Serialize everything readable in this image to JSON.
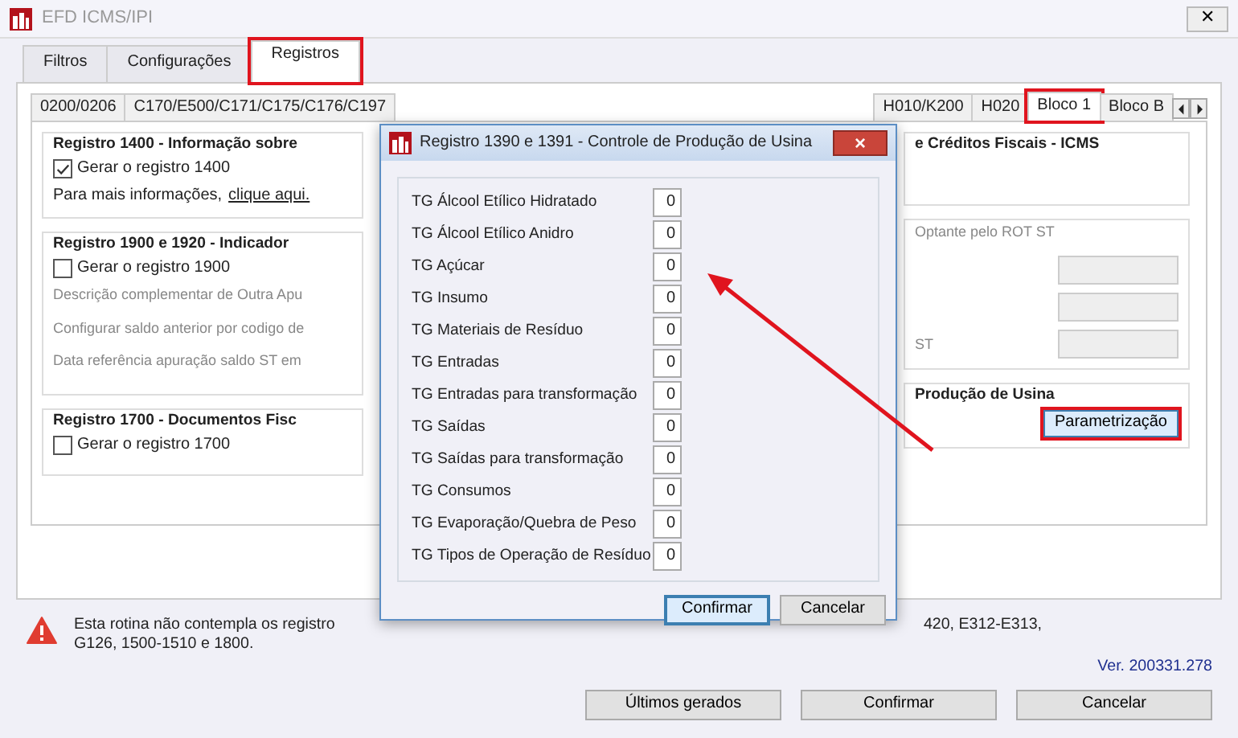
{
  "window": {
    "title": "EFD ICMS/IPI",
    "close": "✕"
  },
  "tabs": [
    {
      "label": "Filtros",
      "selected": false,
      "highlighted": false
    },
    {
      "label": "Configurações",
      "selected": false,
      "highlighted": false
    },
    {
      "label": "Registros",
      "selected": true,
      "highlighted": true
    }
  ],
  "sub_tabs_left": [
    {
      "label": "0200/0206",
      "selected": false,
      "highlighted": false
    },
    {
      "label": "C170/E500/C171/C175/C176/C197",
      "selected": false,
      "highlighted": false
    }
  ],
  "sub_tabs_right": [
    {
      "label": "H010/K200",
      "selected": false,
      "highlighted": false
    },
    {
      "label": "H020",
      "selected": false,
      "highlighted": false
    },
    {
      "label": "Bloco 1",
      "selected": true,
      "highlighted": true
    },
    {
      "label": "Bloco B",
      "selected": false,
      "highlighted": false
    }
  ],
  "left_groups": [
    {
      "title": "Registro 1400 - Informação sobre",
      "items": [
        {
          "kind": "checkbox",
          "label": "Gerar o registro 1400",
          "checked": true
        },
        {
          "kind": "link_line",
          "text": "Para mais informações, ",
          "link": "clique aqui."
        }
      ]
    },
    {
      "title": "Registro 1900 e 1920 - Indicador",
      "items": [
        {
          "kind": "checkbox",
          "label": "Gerar o registro 1900",
          "checked": false
        },
        {
          "kind": "note",
          "text": "Descrição complementar de Outra Apu"
        },
        {
          "kind": "note",
          "text": "Configurar saldo anterior por codigo de"
        },
        {
          "kind": "note",
          "text": "Data referência apuração saldo ST em"
        }
      ]
    },
    {
      "title": "Registro 1700 - Documentos Fisc",
      "items": [
        {
          "kind": "checkbox",
          "label": "Gerar o registro 1700",
          "checked": false
        }
      ]
    }
  ],
  "right_groups": [
    {
      "title": "e Créditos Fiscais - ICMS"
    },
    {
      "items": [
        {
          "kind": "note",
          "text": "Optante pelo ROT ST"
        },
        {
          "kind": "field"
        },
        {
          "kind": "field"
        },
        {
          "kind": "labeled_field",
          "text": "ST"
        }
      ]
    },
    {
      "title": "Produção de Usina",
      "items": [
        {
          "kind": "button",
          "label": "Parametrização",
          "highlighted": true
        }
      ]
    }
  ],
  "notice": {
    "line_1_start": "Esta rotina não contempla os registro",
    "line_1_end": "420, E312-E313,",
    "line_2": "G126, 1500-1510 e 1800.",
    "version": "Ver. 200331.278"
  },
  "buttons": [
    "Últimos gerados",
    "Confirmar",
    "Cancelar"
  ],
  "dialog": {
    "title": "Registro 1390 e 1391 - Controle de Produção de Usina",
    "close": "×",
    "fields": [
      {
        "label": "TG Álcool Etílico Hidratado",
        "value": "0"
      },
      {
        "label": "TG Álcool Etílico Anidro",
        "value": "0"
      },
      {
        "label": "TG Açúcar",
        "value": "0"
      },
      {
        "label": "TG Insumo",
        "value": "0"
      },
      {
        "label": "TG Materiais de Resíduo",
        "value": "0"
      },
      {
        "label": "TG Entradas",
        "value": "0"
      },
      {
        "label": "TG Entradas para transformação",
        "value": "0"
      },
      {
        "label": "TG Saídas",
        "value": "0"
      },
      {
        "label": "TG Saídas para transformação",
        "value": "0"
      },
      {
        "label": "TG Consumos",
        "value": "0"
      },
      {
        "label": "TG Evaporação/Quebra de Peso",
        "value": "0"
      },
      {
        "label": "TG Tipos de Operação de Resíduo",
        "value": "0"
      }
    ],
    "buttons": [
      {
        "label": "Confirmar",
        "default": true
      },
      {
        "label": "Cancelar",
        "default": false
      }
    ]
  }
}
